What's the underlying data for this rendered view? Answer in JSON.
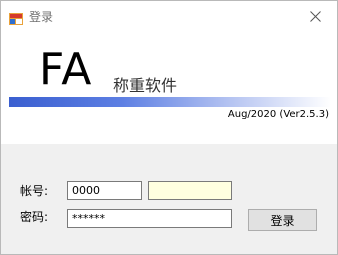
{
  "window": {
    "title": "登录"
  },
  "header": {
    "logo": "FA",
    "subtitle": "称重软件",
    "version": "Aug/2020 (Ver2.5.3)"
  },
  "form": {
    "account_label": "帐号:",
    "account_value": "0000",
    "account_extra_value": "",
    "password_label": "密码:",
    "password_value": "******",
    "login_button": "登录"
  },
  "colors": {
    "gradient_start": "#3a5fd0",
    "gradient_end": "#ffffff",
    "extra_field_bg": "#ffffe0"
  }
}
